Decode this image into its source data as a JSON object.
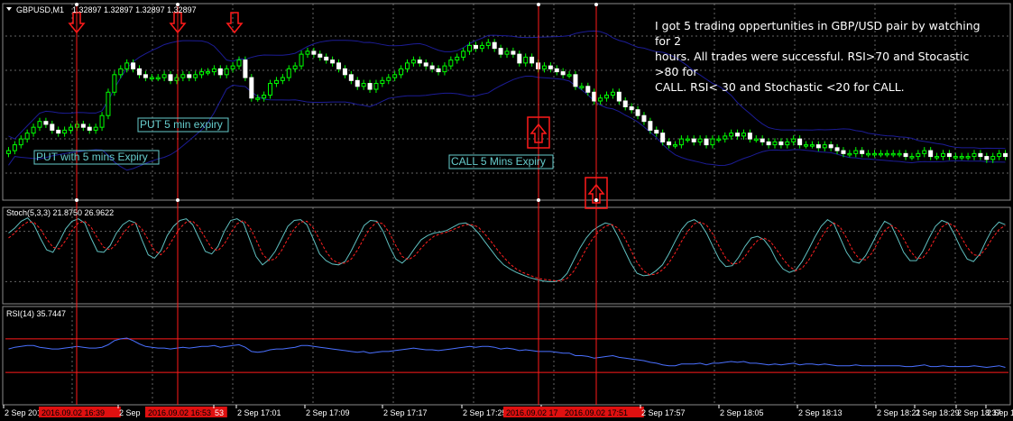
{
  "window": {
    "symbol_label": "GBPUSD,M1",
    "ohlc": "1.32897 1.32897 1.32897 1.32897"
  },
  "note": {
    "line1": "I got 5 trading oppertunities in GBP/USD pair by watching for 2",
    "line2": "hours. All trades were successful. RSI>70 and Stocastic >80 for",
    "line3": "CALL.      RSI< 30 and Stochastic <20 for CALL."
  },
  "chart_data": [
    {
      "type": "candlestick",
      "panel": "price",
      "colors": {
        "background": "#000000",
        "grid": "#646464",
        "candle_up": "#00ff00",
        "candle_down": "#ffffff",
        "bollinger": "#1c1c96",
        "signal_line": "#ff1a1a",
        "label_box": "#66cccc"
      },
      "grid": true,
      "annotations": [
        {
          "text": "PUT with 5 mins Expiry",
          "kind": "label"
        },
        {
          "text": "PUT 5 min expiry",
          "kind": "label"
        },
        {
          "text": "CALL 5 Mins Expiry",
          "kind": "label"
        }
      ],
      "signals": [
        {
          "direction": "down",
          "time": "2016.09.02 16:39"
        },
        {
          "direction": "down",
          "time": "2016.09.02 16:53"
        },
        {
          "direction": "down",
          "time": ""
        },
        {
          "direction": "up",
          "time": "2016.09.02 17"
        },
        {
          "direction": "up",
          "time": "2016.09.02 17:51"
        }
      ],
      "close": [
        1.3258,
        1.326,
        1.3262,
        1.3264,
        1.3266,
        1.3268,
        1.3267,
        1.3265,
        1.3264,
        1.3265,
        1.3266,
        1.3267,
        1.3266,
        1.3265,
        1.3266,
        1.327,
        1.3278,
        1.3284,
        1.3286,
        1.3288,
        1.3286,
        1.3284,
        1.3283,
        1.3283,
        1.3283,
        1.3284,
        1.3282,
        1.3283,
        1.3284,
        1.3283,
        1.3284,
        1.3285,
        1.3285,
        1.3286,
        1.3284,
        1.3286,
        1.3287,
        1.3289,
        1.3283,
        1.3276,
        1.3276,
        1.3277,
        1.3281,
        1.3282,
        1.3283,
        1.3286,
        1.3287,
        1.3291,
        1.3292,
        1.3291,
        1.329,
        1.3289,
        1.3288,
        1.3286,
        1.3284,
        1.3282,
        1.328,
        1.3281,
        1.3279,
        1.3281,
        1.3282,
        1.3283,
        1.3284,
        1.3286,
        1.3288,
        1.3289,
        1.3288,
        1.3287,
        1.3286,
        1.3285,
        1.3287,
        1.3289,
        1.329,
        1.3292,
        1.3294,
        1.3293,
        1.3294,
        1.3295,
        1.3293,
        1.3291,
        1.3292,
        1.3291,
        1.3288,
        1.329,
        1.3288,
        1.3286,
        1.3287,
        1.3286,
        1.3285,
        1.3284,
        1.3284,
        1.328,
        1.328,
        1.3278,
        1.3275,
        1.3276,
        1.3277,
        1.3278,
        1.3275,
        1.3273,
        1.3272,
        1.327,
        1.3268,
        1.3265,
        1.3264,
        1.3261,
        1.326,
        1.326,
        1.3262,
        1.3262,
        1.3261,
        1.3262,
        1.326,
        1.3262,
        1.3262,
        1.3263,
        1.3264,
        1.3263,
        1.3264,
        1.3262,
        1.3262,
        1.3261,
        1.326,
        1.3261,
        1.326,
        1.3261,
        1.3262,
        1.326,
        1.326,
        1.326,
        1.3259,
        1.326,
        1.3259,
        1.3258,
        1.3257,
        1.3257,
        1.3258,
        1.3257,
        1.3257,
        1.3257,
        1.3257,
        1.3257,
        1.3257,
        1.3257,
        1.3256,
        1.3256,
        1.3257,
        1.3258,
        1.3256,
        1.3256,
        1.3257,
        1.3256,
        1.3256,
        1.3256,
        1.3256,
        1.3257,
        1.3256,
        1.3255,
        1.3256,
        1.3257,
        1.3256
      ]
    },
    {
      "type": "line",
      "panel": "stochastic",
      "title": "Stoch(5,3,3) 21.8750 26.9622",
      "ylim": [
        0,
        100
      ],
      "series": [
        {
          "color": "#5fbfbf",
          "values": [
            78,
            84,
            92,
            96,
            88,
            72,
            58,
            55,
            68,
            83,
            92,
            95,
            90,
            72,
            56,
            55,
            63,
            78,
            88,
            93,
            90,
            70,
            52,
            48,
            57,
            75,
            86,
            93,
            95,
            88,
            72,
            56,
            53,
            62,
            80,
            93,
            95,
            90,
            70,
            50,
            40,
            46,
            56,
            71,
            86,
            93,
            94,
            88,
            71,
            53,
            45,
            41,
            40,
            44,
            57,
            72,
            87,
            93,
            92,
            80,
            62,
            47,
            42,
            49,
            60,
            70,
            75,
            78,
            79,
            81,
            85,
            89,
            90,
            86,
            78,
            68,
            58,
            48,
            40,
            35,
            31,
            28,
            25,
            23,
            21,
            20,
            20,
            22,
            30,
            45,
            60,
            72,
            81,
            86,
            90,
            88,
            74,
            58,
            42,
            30,
            27,
            28,
            33,
            40,
            53,
            68,
            82,
            91,
            94,
            89,
            77,
            61,
            46,
            38,
            39,
            49,
            62,
            72,
            74,
            70,
            60,
            45,
            35,
            31,
            34,
            44,
            58,
            73,
            86,
            94,
            89,
            72,
            55,
            44,
            42,
            51,
            65,
            80,
            92,
            88,
            72,
            55,
            45,
            45,
            56,
            72,
            86,
            93,
            90,
            76,
            60,
            47,
            44,
            53,
            69,
            83,
            91,
            88
          ]
        },
        {
          "color": "#ff2020",
          "dash": true,
          "values": [
            72,
            78,
            86,
            91,
            91,
            83,
            71,
            61,
            59,
            69,
            81,
            90,
            92,
            85,
            72,
            61,
            58,
            65,
            77,
            86,
            90,
            83,
            70,
            57,
            52,
            60,
            72,
            84,
            91,
            92,
            85,
            72,
            60,
            57,
            65,
            78,
            89,
            93,
            85,
            70,
            53,
            45,
            47,
            57,
            71,
            83,
            91,
            92,
            84,
            70,
            56,
            46,
            42,
            42,
            47,
            58,
            72,
            84,
            91,
            89,
            78,
            63,
            50,
            46,
            51,
            60,
            68,
            74,
            77,
            79,
            82,
            85,
            88,
            88,
            85,
            77,
            68,
            58,
            49,
            41,
            35,
            31,
            28,
            25,
            23,
            22,
            21,
            21,
            24,
            32,
            45,
            59,
            71,
            80,
            86,
            88,
            84,
            73,
            58,
            43,
            33,
            28,
            29,
            34,
            42,
            54,
            68,
            80,
            89,
            91,
            87,
            76,
            61,
            48,
            41,
            42,
            50,
            61,
            69,
            72,
            68,
            58,
            47,
            38,
            33,
            36,
            45,
            58,
            72,
            84,
            90,
            85,
            72,
            57,
            47,
            46,
            54,
            68,
            81,
            87,
            83,
            71,
            57,
            48,
            48,
            58,
            72,
            85,
            90,
            86,
            74,
            61,
            52,
            51,
            60,
            72,
            82,
            87
          ]
        }
      ]
    },
    {
      "type": "line",
      "panel": "rsi",
      "title": "RSI(14) 35.7447",
      "ylim": [
        0,
        100
      ],
      "levels": [
        70,
        30
      ],
      "series": [
        {
          "color": "#4a70ff",
          "values": [
            58,
            60,
            61,
            62,
            62,
            60,
            59,
            58,
            58,
            59,
            60,
            61,
            60,
            59,
            59,
            60,
            63,
            68,
            70,
            71,
            68,
            64,
            61,
            60,
            59,
            59,
            58,
            59,
            60,
            59,
            60,
            61,
            61,
            62,
            60,
            61,
            62,
            63,
            60,
            55,
            54,
            55,
            57,
            58,
            58,
            59,
            60,
            62,
            62,
            61,
            60,
            59,
            58,
            57,
            56,
            55,
            54,
            55,
            53,
            54,
            55,
            55,
            56,
            57,
            58,
            59,
            58,
            57,
            57,
            56,
            57,
            58,
            59,
            60,
            61,
            60,
            61,
            61,
            60,
            58,
            59,
            58,
            56,
            57,
            56,
            55,
            55,
            55,
            54,
            53,
            53,
            50,
            50,
            49,
            47,
            48,
            49,
            50,
            48,
            47,
            46,
            45,
            44,
            42,
            41,
            39,
            38,
            38,
            40,
            40,
            40,
            41,
            39,
            41,
            41,
            42,
            43,
            42,
            43,
            41,
            41,
            40,
            39,
            40,
            39,
            40,
            41,
            39,
            40,
            40,
            39,
            40,
            39,
            38,
            38,
            38,
            39,
            38,
            38,
            38,
            38,
            38,
            38,
            38,
            37,
            37,
            38,
            39,
            37,
            37,
            38,
            37,
            37,
            37,
            37,
            38,
            37,
            36,
            37,
            38,
            36
          ]
        }
      ]
    }
  ],
  "x_axis": {
    "ticks": [
      "2 Sep 201",
      "2016.09.02 16:39",
      "2 Sep",
      "2016.09.02 16:53",
      "53",
      "2 Sep 17:01",
      "2 Sep 17:09",
      "2 Sep 17:17",
      "2 Sep 17:25",
      "2 Sep 17:",
      "2016.09.02 17",
      "2016.09.02 17:51",
      "2 Sep 17:57",
      "2 Sep 18:05",
      "2 Sep 18:13",
      "2 Sep 18:21",
      "2 Sep 18:29",
      "2 Sep 18:37",
      "2 Sep 1"
    ]
  }
}
